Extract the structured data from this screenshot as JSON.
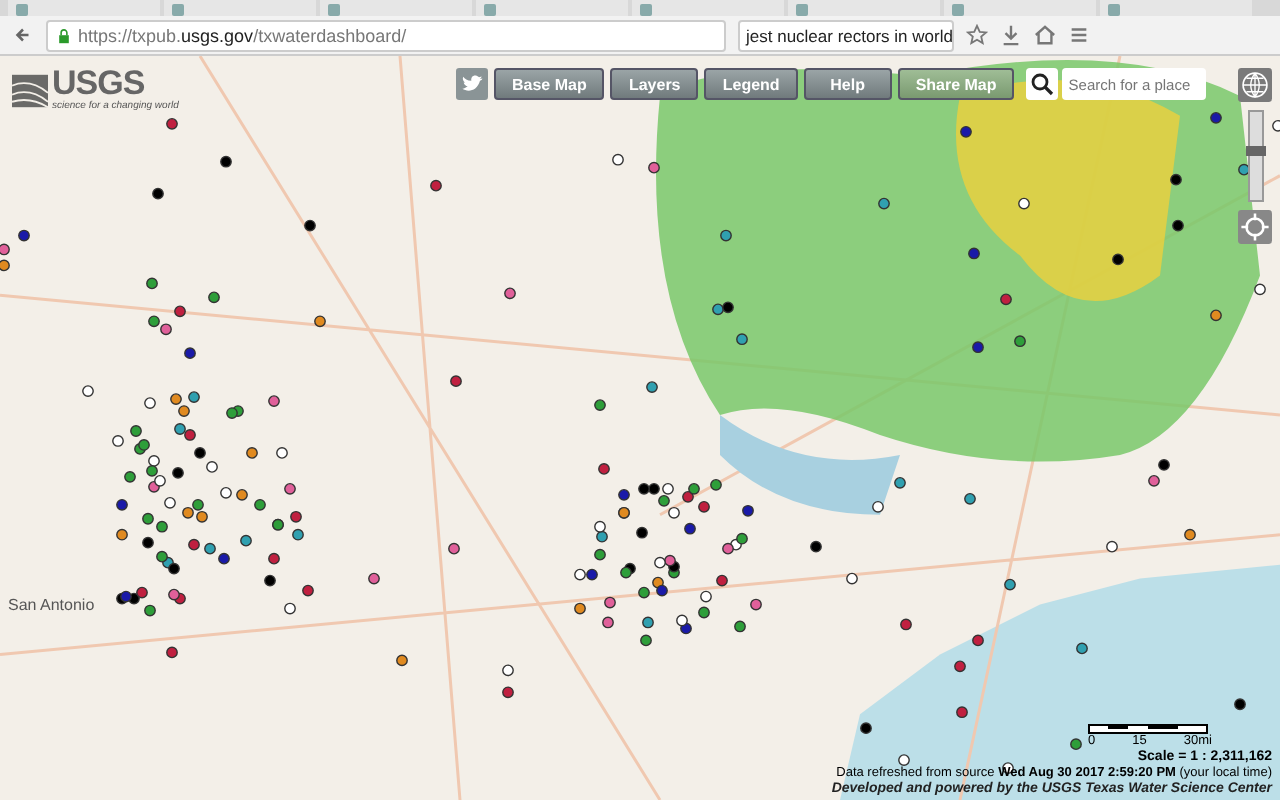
{
  "browser": {
    "url_prefix": "https://txpub.",
    "url_domain": "usgs.gov",
    "url_path": "/txwaterdashboard/",
    "search_value": "jest nuclear rectors in world"
  },
  "app": {
    "logo": "USGS",
    "tagline": "science for a changing world",
    "buttons": [
      {
        "label": "Base Map",
        "kind": "plain"
      },
      {
        "label": "Layers",
        "kind": "plain"
      },
      {
        "label": "Legend",
        "kind": "plain"
      },
      {
        "label": "Help",
        "kind": "plain"
      },
      {
        "label": "Share Map",
        "kind": "accent"
      }
    ],
    "search": {
      "placeholder": "Search for a place"
    },
    "zoom": {
      "level": 0.55
    },
    "map_label": "San Antonio",
    "scale": {
      "ticks": [
        "0",
        "15",
        "30mi"
      ],
      "ratio": "Scale = 1 : 2,311,162"
    },
    "refresh": "Data refreshed from source **Wed Aug 30 2017 2:59:20 PM** (your local time)",
    "credit": "Developed and powered by the USGS Texas Water Science Center"
  }
}
